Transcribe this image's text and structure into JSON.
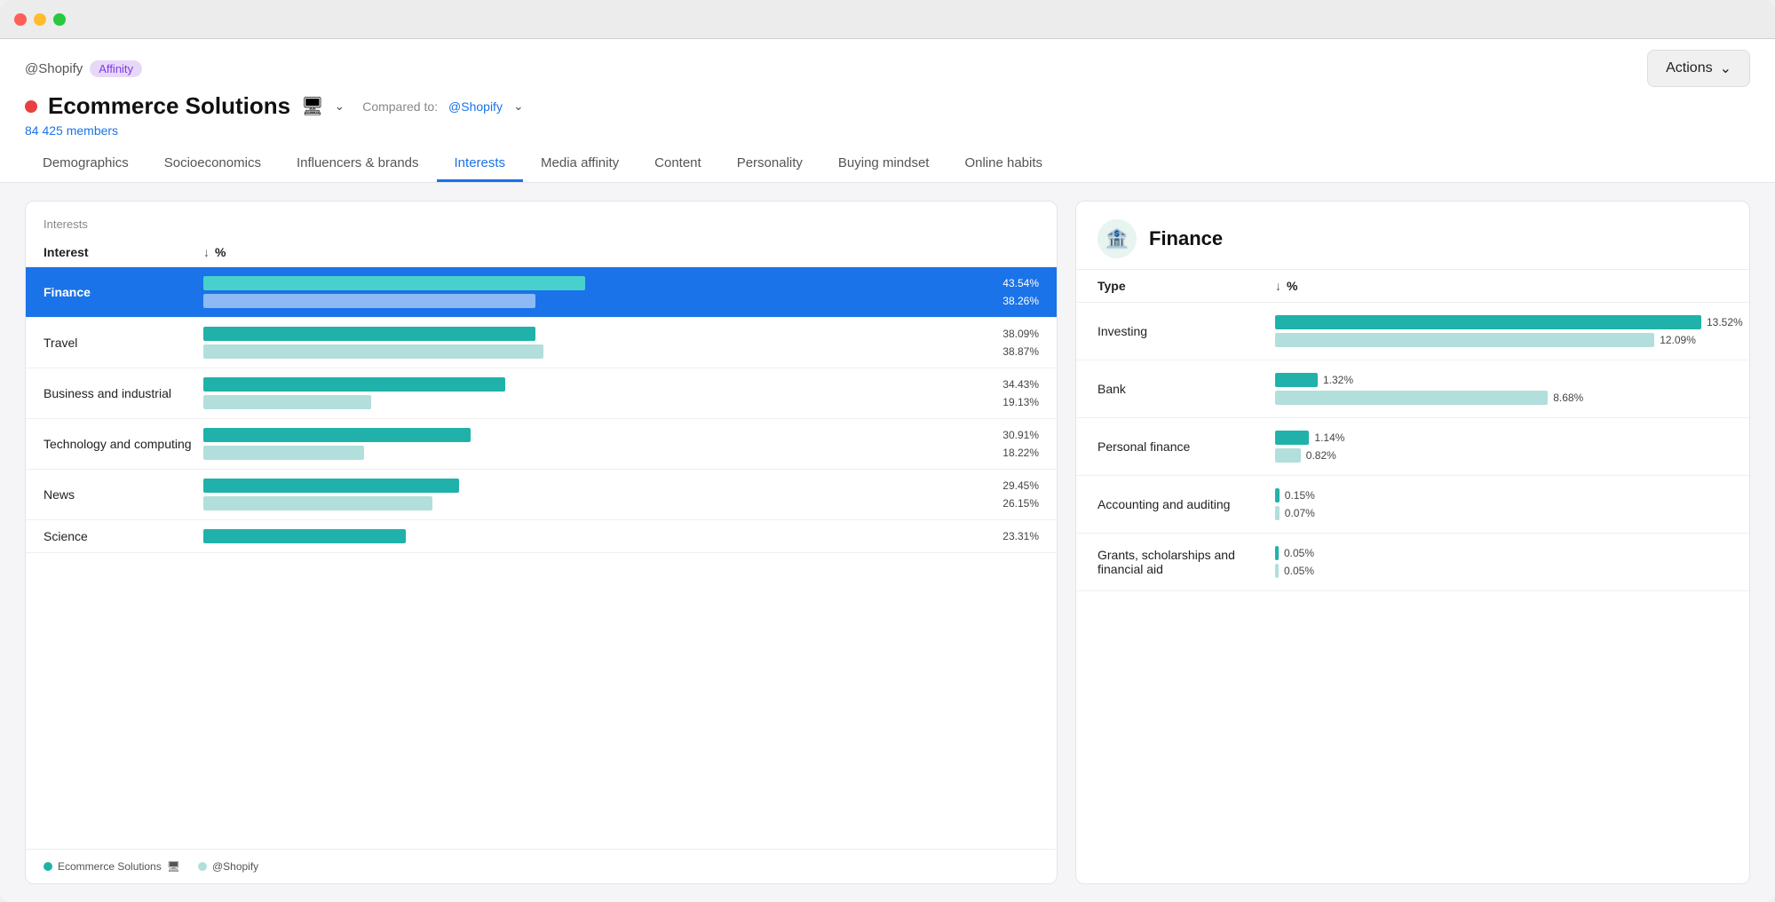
{
  "window": {
    "titlebar": {
      "shopify_label": "@Shopify",
      "affinity_badge": "Affinity"
    }
  },
  "header": {
    "page_title": "Ecommerce Solutions",
    "red_dot": true,
    "compared_to_label": "Compared to:",
    "compared_to_value": "@Shopify",
    "members_count": "84 425 members",
    "actions_label": "Actions"
  },
  "nav": {
    "tabs": [
      {
        "id": "demographics",
        "label": "Demographics",
        "active": false
      },
      {
        "id": "socioeconomics",
        "label": "Socioeconomics",
        "active": false
      },
      {
        "id": "influencers",
        "label": "Influencers & brands",
        "active": false
      },
      {
        "id": "interests",
        "label": "Interests",
        "active": true
      },
      {
        "id": "media_affinity",
        "label": "Media affinity",
        "active": false
      },
      {
        "id": "content",
        "label": "Content",
        "active": false
      },
      {
        "id": "personality",
        "label": "Personality",
        "active": false
      },
      {
        "id": "buying_mindset",
        "label": "Buying mindset",
        "active": false
      },
      {
        "id": "online_habits",
        "label": "Online habits",
        "active": false
      }
    ]
  },
  "left_panel": {
    "section_title": "Interests",
    "col_interest": "Interest",
    "col_percent": "%",
    "interests": [
      {
        "label": "Finance",
        "selected": true,
        "primary_val": "43.54%",
        "secondary_val": "38.26%",
        "primary_pct": 100,
        "secondary_pct": 87
      },
      {
        "label": "Travel",
        "selected": false,
        "primary_val": "38.09%",
        "secondary_val": "38.87%",
        "primary_pct": 87,
        "secondary_pct": 89
      },
      {
        "label": "Business and industrial",
        "selected": false,
        "primary_val": "34.43%",
        "secondary_val": "19.13%",
        "primary_pct": 79,
        "secondary_pct": 44
      },
      {
        "label": "Technology and computing",
        "selected": false,
        "primary_val": "30.91%",
        "secondary_val": "18.22%",
        "primary_pct": 70,
        "secondary_pct": 42
      },
      {
        "label": "News",
        "selected": false,
        "primary_val": "29.45%",
        "secondary_val": "26.15%",
        "primary_pct": 67,
        "secondary_pct": 60
      },
      {
        "label": "Science",
        "selected": false,
        "primary_val": "23.31%",
        "secondary_val": "",
        "primary_pct": 53,
        "secondary_pct": 0
      }
    ],
    "legend": {
      "primary_label": "Ecommerce Solutions",
      "secondary_label": "@Shopify"
    }
  },
  "right_panel": {
    "title": "Finance",
    "icon": "🏦",
    "col_type": "Type",
    "col_percent": "%",
    "types": [
      {
        "label": "Investing",
        "primary_val": "13.52%",
        "secondary_val": "12.09%",
        "primary_pct": 100,
        "secondary_pct": 89
      },
      {
        "label": "Bank",
        "primary_val": "1.32%",
        "secondary_val": "8.68%",
        "primary_pct": 10,
        "secondary_pct": 64
      },
      {
        "label": "Personal finance",
        "primary_val": "1.14%",
        "secondary_val": "0.82%",
        "primary_pct": 8,
        "secondary_pct": 6
      },
      {
        "label": "Accounting and auditing",
        "primary_val": "0.15%",
        "secondary_val": "0.07%",
        "primary_pct": 1,
        "secondary_pct": 1
      },
      {
        "label": "Grants, scholarships and financial aid",
        "primary_val": "0.05%",
        "secondary_val": "0.05%",
        "primary_pct": 0.5,
        "secondary_pct": 0.5
      }
    ]
  }
}
